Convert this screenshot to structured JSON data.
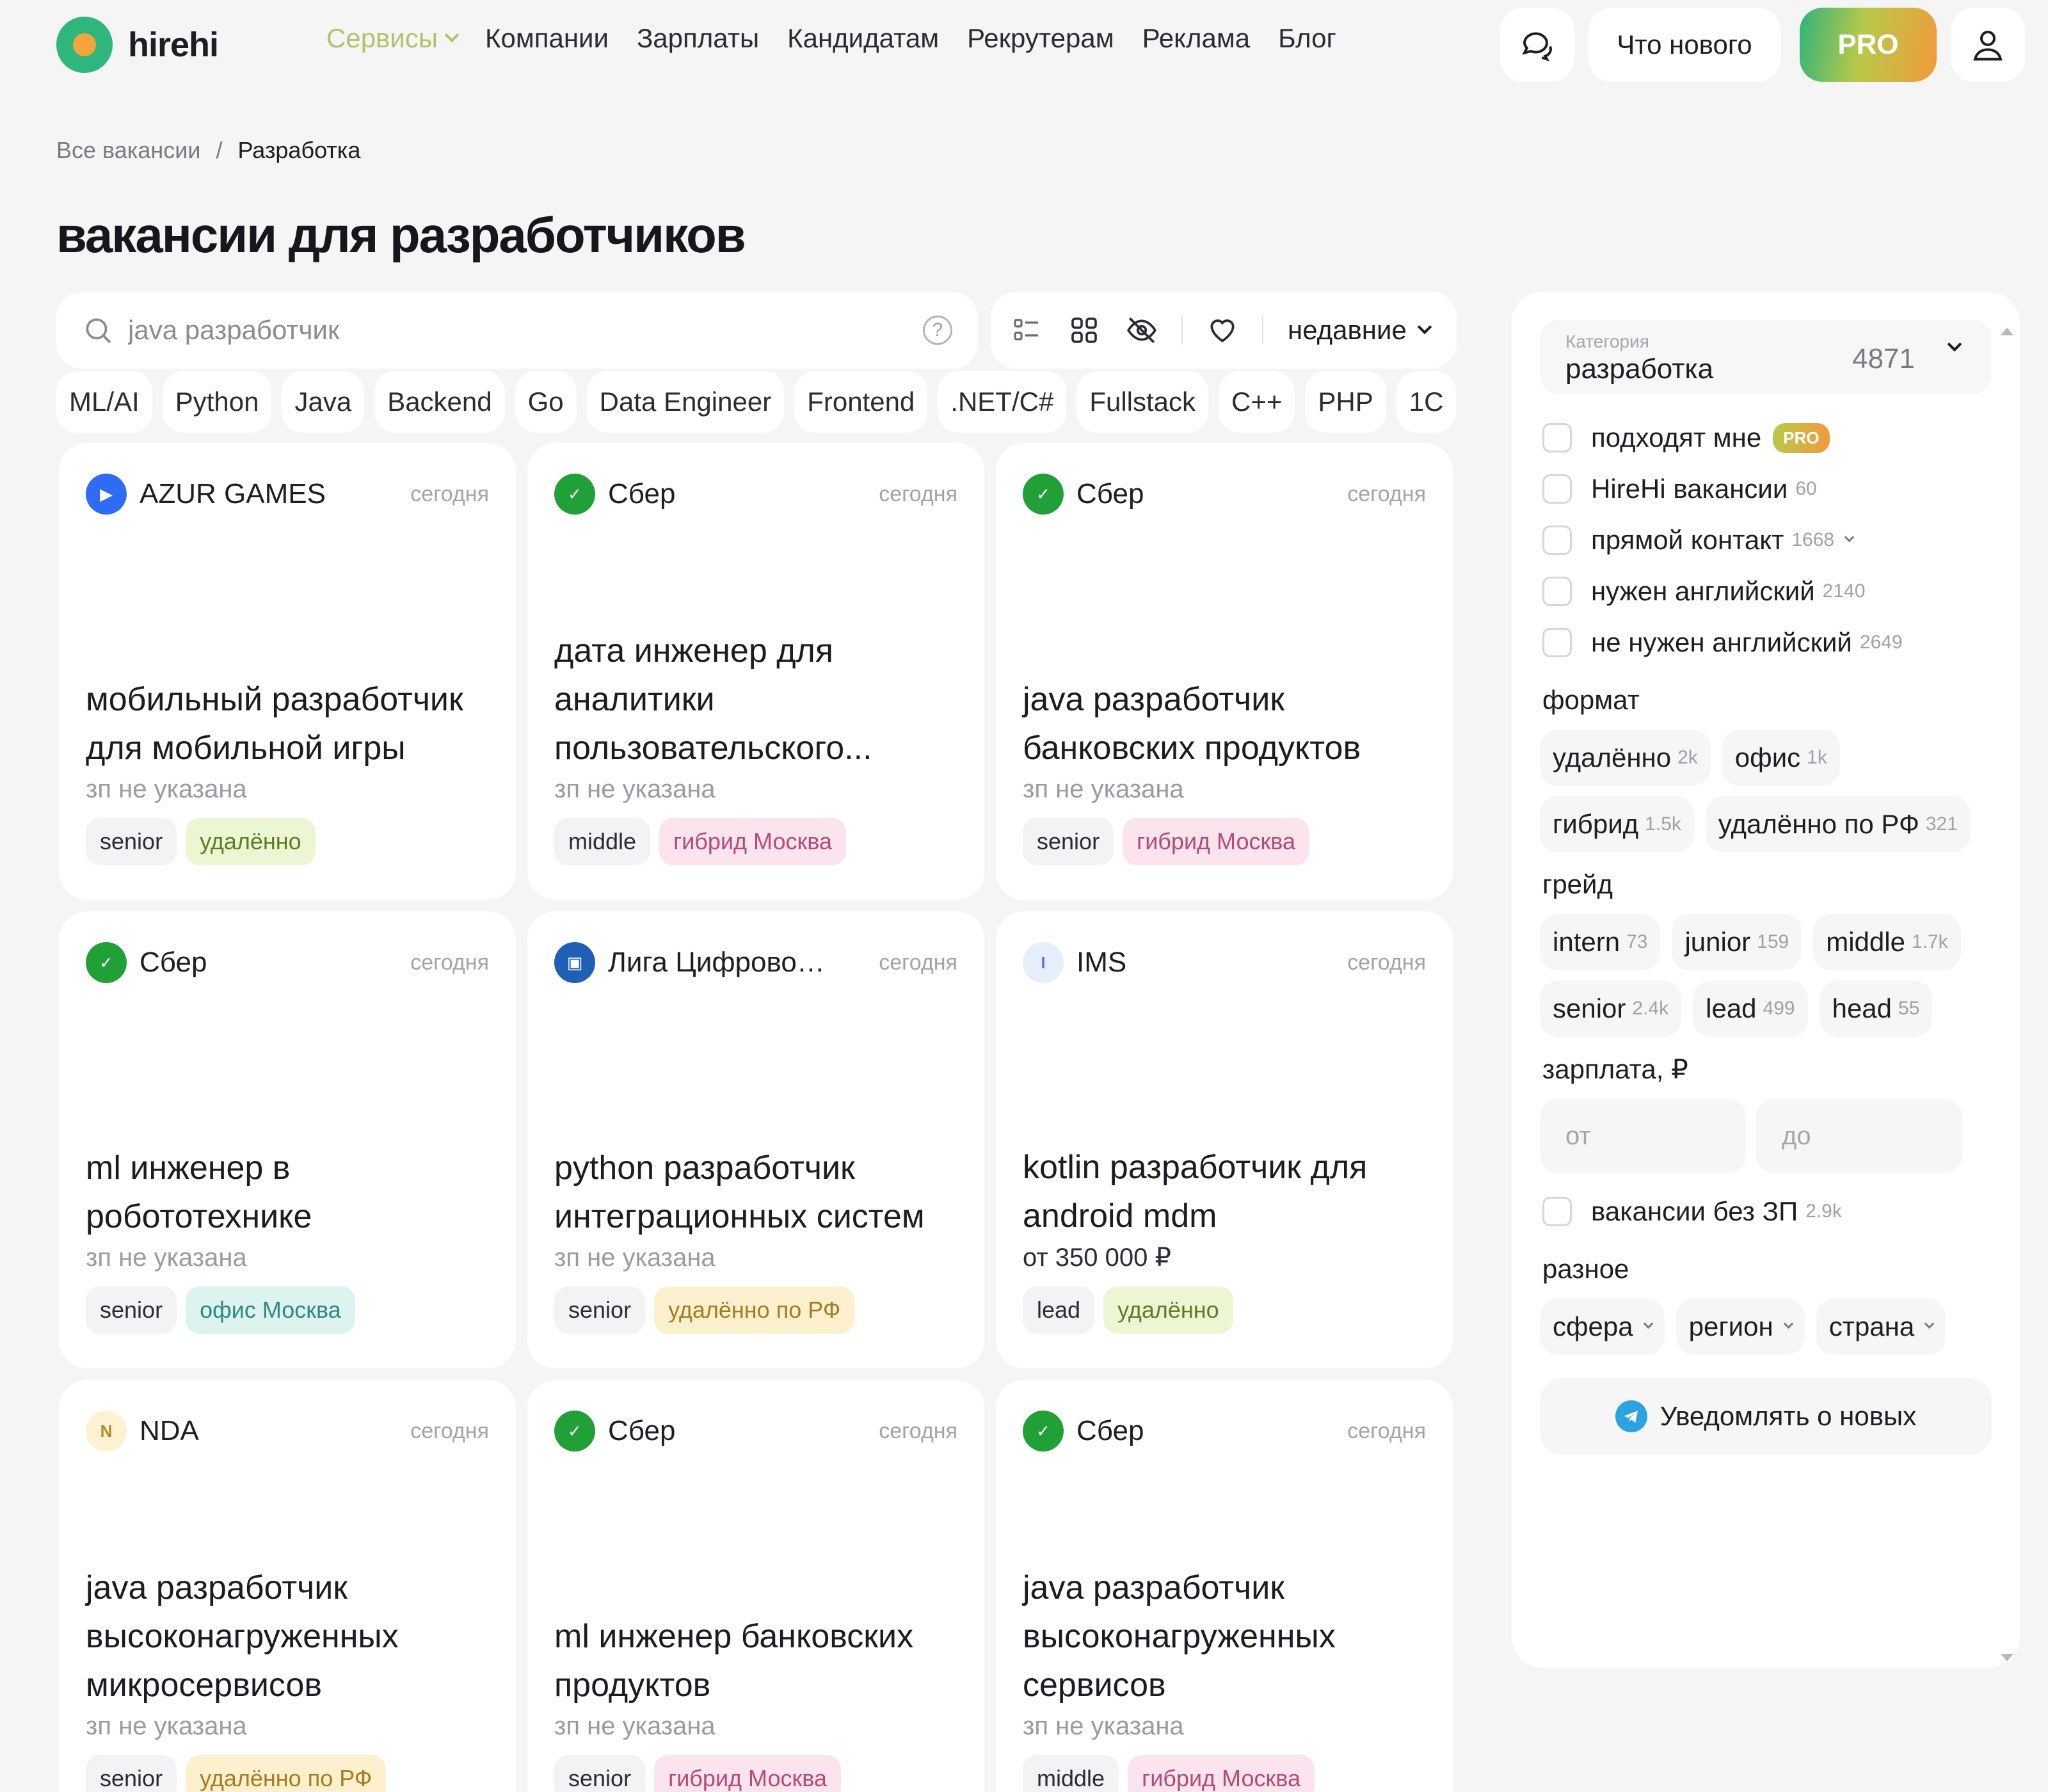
{
  "header": {
    "brand": "hirehi",
    "nav": [
      {
        "label": "Сервисы"
      },
      {
        "label": "Компании"
      },
      {
        "label": "Зарплаты"
      },
      {
        "label": "Кандидатам"
      },
      {
        "label": "Рекрутерам"
      },
      {
        "label": "Реклама"
      },
      {
        "label": "Блог"
      }
    ],
    "whats_new": "Что нового",
    "pro": "PRO"
  },
  "breadcrumb": {
    "root": "Все вакансии",
    "separator": "/",
    "current": "Разработка"
  },
  "page_title": "вакансии для разработчиков",
  "search": {
    "placeholder": "java разработчик",
    "help": "?"
  },
  "toolbar": {
    "sort": "недавние"
  },
  "chips": [
    "ML/AI",
    "Python",
    "Java",
    "Backend",
    "Go",
    "Data Engineer",
    "Frontend",
    ".NET/C#",
    "Fullstack",
    "C++",
    "PHP",
    "1С"
  ],
  "vacancies": [
    {
      "company": "AZUR GAMES",
      "date": "сегодня",
      "title": "мобильный разработчик для мобильной игры",
      "salary": "зп не указана",
      "grade": "senior",
      "format": "удалённо",
      "format_color": "green",
      "logo_icon": "azur-games-logo",
      "logo_bg": "#2f6cf6",
      "logo_fg": "#ffffff",
      "logo_char": "▶"
    },
    {
      "company": "Сбер",
      "date": "сегодня",
      "title": "дата инженер для аналитики пользовательского...",
      "salary": "зп не указана",
      "grade": "middle",
      "format": "гибрид Москва",
      "format_color": "pink",
      "logo_icon": "sber-logo",
      "logo_bg": "#21a038",
      "logo_fg": "#ffffff",
      "logo_char": "✓"
    },
    {
      "company": "Сбер",
      "date": "сегодня",
      "title": "java разработчик банковских продуктов",
      "salary": "зп не указана",
      "grade": "senior",
      "format": "гибрид Москва",
      "format_color": "pink",
      "logo_icon": "sber-logo",
      "logo_bg": "#21a038",
      "logo_fg": "#ffffff",
      "logo_char": "✓"
    },
    {
      "company": "Сбер",
      "date": "сегодня",
      "title": "ml инженер в робототехнике",
      "salary": "зп не указана",
      "grade": "senior",
      "format": "офис Москва",
      "format_color": "teal",
      "logo_icon": "sber-logo",
      "logo_bg": "#21a038",
      "logo_fg": "#ffffff",
      "logo_char": "✓"
    },
    {
      "company": "Лига Цифровой ...",
      "date": "сегодня",
      "title": "python разработчик интеграционных систем",
      "salary": "зп не указана",
      "grade": "senior",
      "format": "удалённо по РФ",
      "format_color": "yellow",
      "logo_icon": "liga-logo",
      "logo_bg": "#1f5fb6",
      "logo_fg": "#ffffff",
      "logo_char": "▣"
    },
    {
      "company": "IMS",
      "date": "сегодня",
      "title": "kotlin разработчик для android mdm",
      "salary": "от 350 000 ₽",
      "grade": "lead",
      "format": "удалённо",
      "format_color": "green",
      "logo_icon": "ims-logo",
      "logo_bg": "#e6eefb",
      "logo_fg": "#5b7bd5",
      "logo_char": "I"
    },
    {
      "company": "NDA",
      "date": "сегодня",
      "title": "java разработчик высоконагруженных микросервисов",
      "salary": "зп не указана",
      "grade": "senior",
      "format": "удалённо по РФ",
      "format_color": "yellow",
      "logo_icon": "nda-logo",
      "logo_bg": "#fdf3d2",
      "logo_fg": "#b48a2a",
      "logo_char": "N"
    },
    {
      "company": "Сбер",
      "date": "сегодня",
      "title": "ml инженер банковских продуктов",
      "salary": "зп не указана",
      "grade": "senior",
      "format": "гибрид Москва",
      "format_color": "pink",
      "logo_icon": "sber-logo",
      "logo_bg": "#21a038",
      "logo_fg": "#ffffff",
      "logo_char": "✓"
    },
    {
      "company": "Сбер",
      "date": "сегодня",
      "title": "java разработчик высоконагруженных сервисов",
      "salary": "зп не указана",
      "grade": "middle",
      "format": "гибрид Москва",
      "format_color": "pink",
      "logo_icon": "sber-logo",
      "logo_bg": "#21a038",
      "logo_fg": "#ffffff",
      "logo_char": "✓"
    }
  ],
  "sidebar": {
    "category": {
      "label": "Категория",
      "value": "разработка",
      "count": "4871"
    },
    "checks": [
      {
        "label": "подходят мне",
        "count": "",
        "pro": "PRO"
      },
      {
        "label": "HireHi вакансии",
        "count": "60"
      },
      {
        "label": "прямой контакт",
        "count": "1668"
      },
      {
        "label": "нужен английский",
        "count": "2140"
      },
      {
        "label": "не нужен английский",
        "count": "2649"
      }
    ],
    "format_title": "формат",
    "formats": [
      {
        "label": "удалённо",
        "count": "2k"
      },
      {
        "label": "офис",
        "count": "1k"
      },
      {
        "label": "гибрид",
        "count": "1.5k"
      },
      {
        "label": "удалённо по РФ",
        "count": "321"
      }
    ],
    "grade_title": "грейд",
    "grades": [
      {
        "label": "intern",
        "count": "73"
      },
      {
        "label": "junior",
        "count": "159"
      },
      {
        "label": "middle",
        "count": "1.7k"
      },
      {
        "label": "senior",
        "count": "2.4k"
      },
      {
        "label": "lead",
        "count": "499"
      },
      {
        "label": "head",
        "count": "55"
      }
    ],
    "salary_title": "зарплата, ₽",
    "salary_from": "от",
    "salary_to": "до",
    "no_salary": {
      "label": "вакансии без ЗП",
      "count": "2.9k"
    },
    "misc_title": "разное",
    "misc": [
      "сфера",
      "регион",
      "страна"
    ],
    "notify": "Уведомлять о новых"
  }
}
